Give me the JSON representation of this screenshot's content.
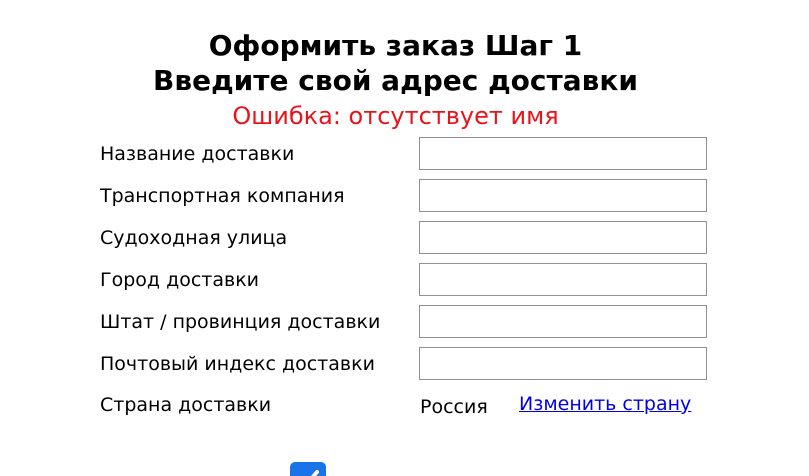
{
  "page": {
    "title_line1": "Оформить заказ Шаг 1",
    "title_line2": "Введите свой адрес доставки",
    "error_message": "Ошибка: отсутствует имя"
  },
  "form": {
    "shipping_name": {
      "label": "Название доставки",
      "value": ""
    },
    "shipping_company": {
      "label": "Транспортная компания",
      "value": ""
    },
    "shipping_street": {
      "label": "Судоходная улица",
      "value": ""
    },
    "shipping_city": {
      "label": "Город доставки",
      "value": ""
    },
    "shipping_state": {
      "label": "Штат / провинция доставки",
      "value": ""
    },
    "shipping_zip": {
      "label": "Почтовый индекс доставки",
      "value": ""
    },
    "shipping_country": {
      "label": "Страна доставки",
      "value": "Россия",
      "change_link": "Изменить страну"
    }
  },
  "colors": {
    "error": "#e8141b",
    "link": "#0000ee",
    "checkbox": "#1a73e8"
  },
  "icons": {
    "checkbox": "checkmark-icon"
  }
}
